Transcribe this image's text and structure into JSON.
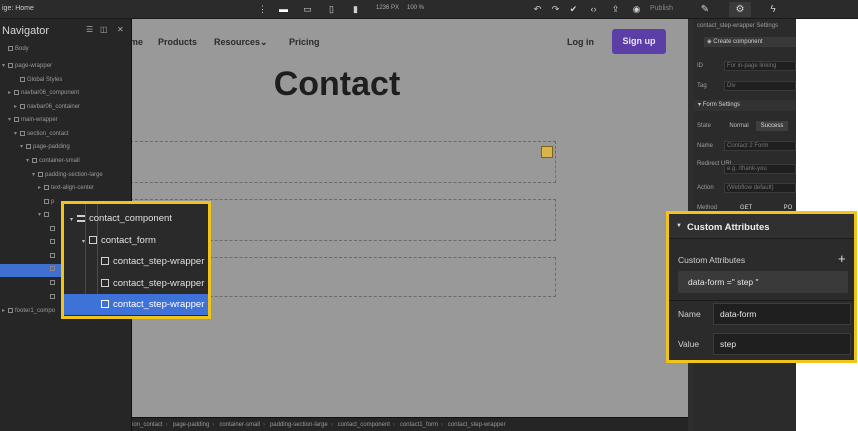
{
  "topbar": {
    "page_select": "ige: Home",
    "size_label": "1236 PX",
    "zoom_label": "100 %",
    "publish_label": "Publish"
  },
  "navigator": {
    "title": "Navigator",
    "tree": [
      {
        "label": "Body",
        "indent": 0,
        "twisty": ""
      },
      {
        "label": "page-wrapper",
        "indent": 0,
        "twisty": "▾"
      },
      {
        "label": "Global Styles",
        "indent": 2,
        "twisty": ""
      },
      {
        "label": "navbar06_component",
        "indent": 1,
        "twisty": "▸"
      },
      {
        "label": "navbar06_container",
        "indent": 2,
        "twisty": "▸"
      },
      {
        "label": "main-wrapper",
        "indent": 1,
        "twisty": "▾"
      },
      {
        "label": "section_contact",
        "indent": 2,
        "twisty": "▾"
      },
      {
        "label": "page-padding",
        "indent": 3,
        "twisty": "▾"
      },
      {
        "label": "container-small",
        "indent": 4,
        "twisty": "▾"
      },
      {
        "label": "padding-section-large",
        "indent": 5,
        "twisty": "▾"
      },
      {
        "label": "text-align-center",
        "indent": 6,
        "twisty": "▸"
      },
      {
        "label": "p",
        "indent": 6,
        "twisty": ""
      },
      {
        "label": "",
        "indent": 6,
        "twisty": "▾"
      },
      {
        "label": "",
        "indent": 7,
        "twisty": ""
      },
      {
        "label": "",
        "indent": 7,
        "twisty": ""
      },
      {
        "label": "",
        "indent": 7,
        "twisty": ""
      },
      {
        "label": "",
        "indent": 7,
        "twisty": ""
      },
      {
        "label": "",
        "indent": 7,
        "twisty": ""
      },
      {
        "label": "",
        "indent": 7,
        "twisty": ""
      },
      {
        "label": "footer1_compo",
        "indent": 0,
        "twisty": "▸"
      }
    ]
  },
  "canvas": {
    "nav_links": [
      "me",
      "Products",
      "Resources",
      "Pricing",
      "Log in"
    ],
    "signup_label": "Sign up",
    "heading": "Contact"
  },
  "breadcrumb": [
    "ion_contact",
    "page-padding",
    "container-small",
    "padding-section-large",
    "contact_component",
    "contact1_form",
    "contact_step-wrapper"
  ],
  "right_panel": {
    "element_title": "contact_step-wrapper Settings",
    "create_component_label": "Create component",
    "id_label": "ID",
    "id_placeholder": "For in-page linking",
    "tag_label": "Tag",
    "tag_value": "Div",
    "form_settings_label": "Form Settings",
    "state_label": "State",
    "state_normal": "Normal",
    "state_success": "Success",
    "name_label": "Name",
    "name_value": "Contact 2 Form",
    "redirect_label": "Redirect URL",
    "redirect_placeholder": "e.g. /thank-you",
    "action_label": "Action",
    "action_placeholder": "(Webflow default)",
    "method_label": "Method",
    "method_get": "GET",
    "method_post": "PO"
  },
  "navigator_zoom": {
    "rows": [
      {
        "label": "contact_component",
        "indent": 0,
        "twisty": "▾",
        "icon": "form",
        "selected": false
      },
      {
        "label": "contact_form",
        "indent": 1,
        "twisty": "▾",
        "icon": "box",
        "selected": false
      },
      {
        "label": "contact_step-wrapper",
        "indent": 2,
        "twisty": "",
        "icon": "box",
        "selected": false
      },
      {
        "label": "contact_step-wrapper",
        "indent": 2,
        "twisty": "",
        "icon": "box",
        "selected": false
      },
      {
        "label": "contact_step-wrapper",
        "indent": 2,
        "twisty": "",
        "icon": "box",
        "selected": true
      }
    ]
  },
  "attributes_zoom": {
    "section_title": "Custom Attributes",
    "list_label": "Custom Attributes",
    "add_symbol": "+",
    "item_text": "data-form =\" step \"",
    "name_label": "Name",
    "name_value": "data-form",
    "value_label": "Value",
    "value_value": "step"
  },
  "colors": {
    "callout_border": "#f0c419",
    "selection_blue": "#3f72d8",
    "signup_purple": "#5c3fa6",
    "panel_dark": "#2b2b2b"
  }
}
